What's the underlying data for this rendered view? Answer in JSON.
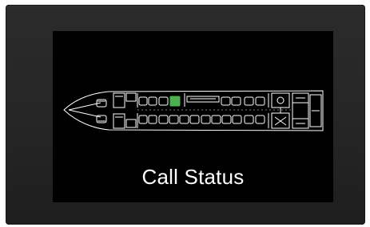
{
  "screen": {
    "title": "Call Status",
    "active_seat_color": "#4caf50",
    "outline_color": "#ffffff",
    "background_color": "#000000"
  }
}
